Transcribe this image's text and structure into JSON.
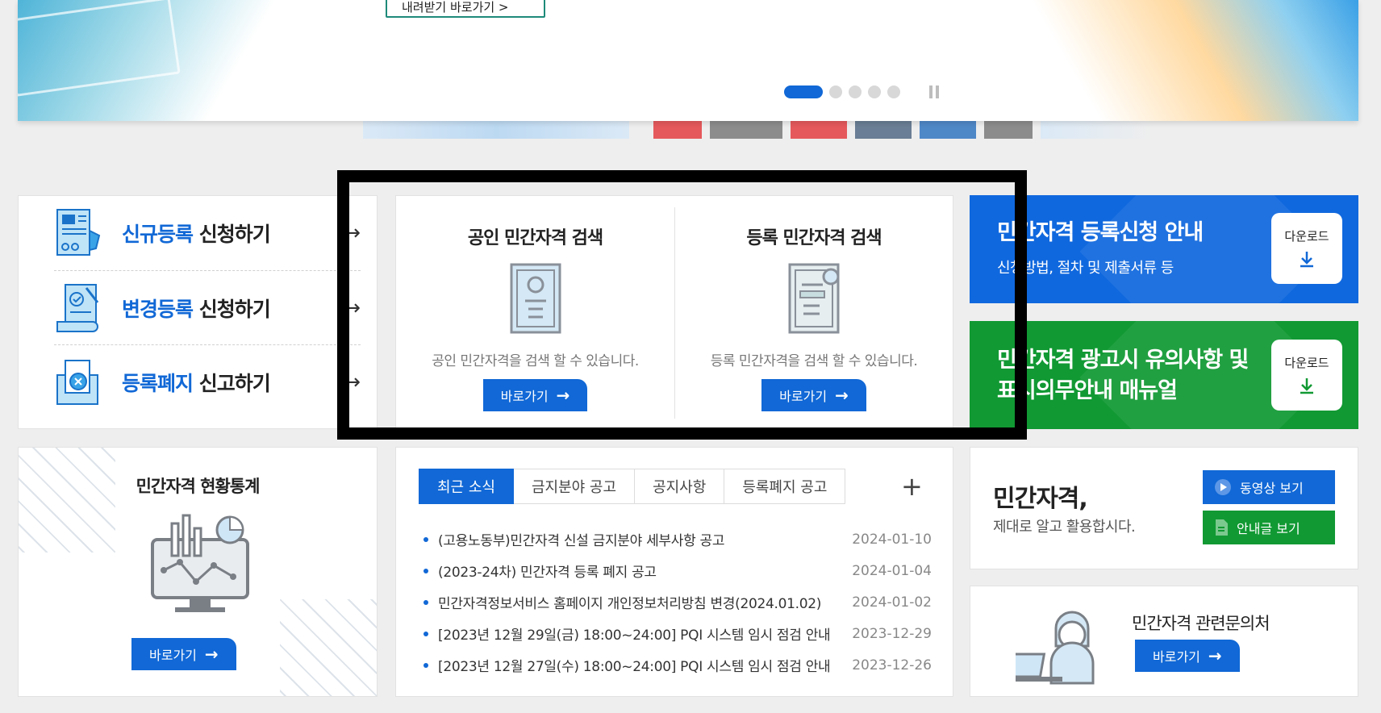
{
  "hero": {
    "cta_label": "내려받기 바로가기 >",
    "slides": 5,
    "active_slide": 1
  },
  "registration": [
    {
      "highlight": "신규등록",
      "rest": " 신청하기",
      "arrow": "→",
      "icon": "new-registration-icon"
    },
    {
      "highlight": "변경등록",
      "rest": " 신청하기",
      "arrow": "→",
      "icon": "change-registration-icon"
    },
    {
      "highlight": "등록폐지",
      "rest": " 신고하기",
      "arrow": "→",
      "icon": "cancel-registration-icon"
    }
  ],
  "search": [
    {
      "title": "공인 민간자격 검색",
      "desc": "공인 민간자격을 검색 할 수 있습니다.",
      "button": "바로가기"
    },
    {
      "title": "등록 민간자격 검색",
      "desc": "등록 민간자격을 검색 할 수 있습니다.",
      "button": "바로가기"
    }
  ],
  "info": [
    {
      "big": "민간자격 등록신청 안내",
      "small": "신청방법, 절차 및 제출서류 등",
      "download": "다운로드",
      "color": "#1068de"
    },
    {
      "big_line1": "민간자격 광고시 유의사항 및",
      "big_line2": "표시의무안내 매뉴얼",
      "download": "다운로드",
      "color": "#119933"
    }
  ],
  "stats": {
    "title": "민간자격 현황통계",
    "button": "바로가기"
  },
  "news": {
    "tabs": [
      "최근 소식",
      "금지분야 공고",
      "공지사항",
      "등록폐지 공고"
    ],
    "active_tab": 0,
    "more": "+",
    "items": [
      {
        "title": "(고용노동부)민간자격 신설 금지분야 세부사항 공고",
        "date": "2024-01-10"
      },
      {
        "title": "(2023-24차) 민간자격 등록 폐지 공고",
        "date": "2024-01-04"
      },
      {
        "title": "민간자격정보서비스 홈페이지 개인정보처리방침 변경(2024.01.02)",
        "date": "2024-01-02"
      },
      {
        "title": "[2023년 12월 29일(금) 18:00~24:00] PQI 시스템 임시 점검 안내",
        "date": "2023-12-29"
      },
      {
        "title": "[2023년 12월 27일(수) 18:00~24:00] PQI 시스템 임시 점검 안내",
        "date": "2023-12-26"
      }
    ]
  },
  "video": {
    "headline": "민간자격,",
    "sub": "제대로 알고 활용합시다.",
    "btn_video": "동영상 보기",
    "btn_guide": "안내글 보기"
  },
  "contact": {
    "title": "민간자격 관련문의처",
    "button": "바로가기"
  },
  "colors": {
    "accent": "#1168d6",
    "green": "#119933"
  }
}
